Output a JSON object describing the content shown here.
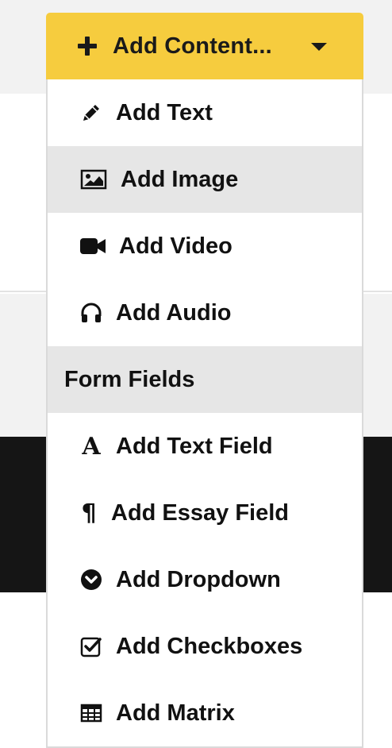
{
  "trigger": {
    "label": "Add Content...",
    "icon": "plus-icon",
    "accent": "#f6cc3e"
  },
  "menu": {
    "items": [
      {
        "label": "Add Text",
        "icon": "pencil-icon"
      },
      {
        "label": "Add Image",
        "icon": "image-icon",
        "highlighted": true
      },
      {
        "label": "Add Video",
        "icon": "video-camera-icon"
      },
      {
        "label": "Add Audio",
        "icon": "headphones-icon"
      }
    ],
    "section_header": "Form Fields",
    "form_items": [
      {
        "label": "Add Text Field",
        "icon": "font-icon",
        "glyph": "A"
      },
      {
        "label": "Add Essay Field",
        "icon": "paragraph-icon",
        "glyph": "¶"
      },
      {
        "label": "Add Dropdown",
        "icon": "chevron-circle-down-icon"
      },
      {
        "label": "Add Checkboxes",
        "icon": "checkbox-icon"
      },
      {
        "label": "Add Matrix",
        "icon": "table-icon"
      }
    ]
  }
}
